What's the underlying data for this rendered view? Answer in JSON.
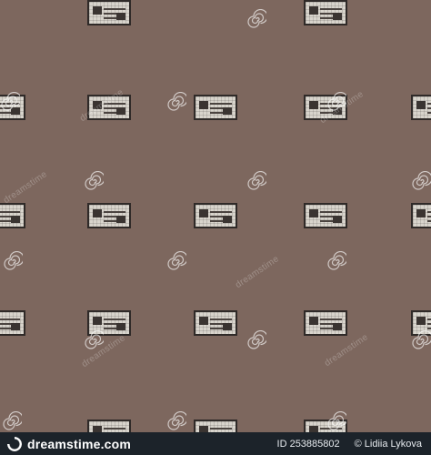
{
  "canvas": {
    "background": "#7d675e"
  },
  "watermark": {
    "text": "dreamstime",
    "color": "#ffffff"
  },
  "pattern": {
    "tile_color": "#d8d4cc",
    "tile_dark": "#2f2a28",
    "spiral_color": "#ffffff"
  },
  "footer": {
    "brand": "dreamstime.com",
    "id_text": "ID 253885802",
    "author": "© Lidiia Lykova",
    "background": "#1c232a"
  }
}
